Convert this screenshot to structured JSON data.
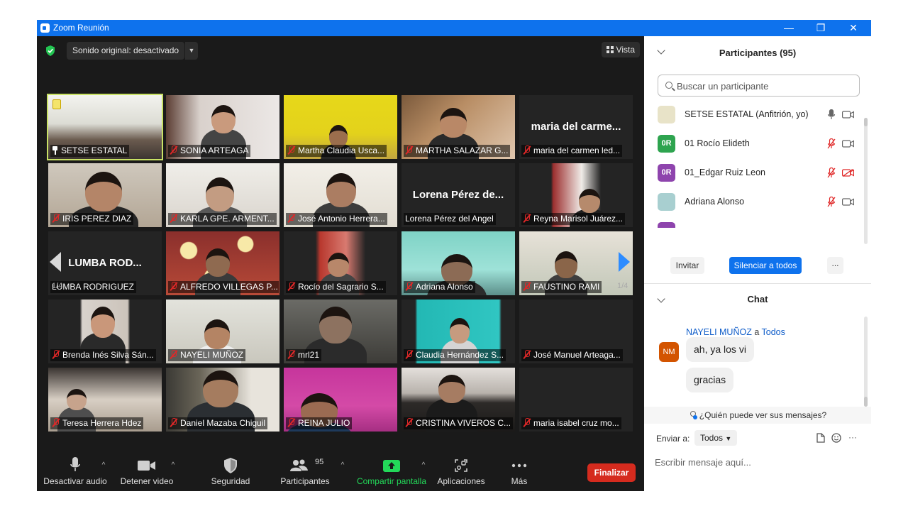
{
  "window": {
    "title": "Zoom Reunión",
    "controls": [
      "—",
      "❐",
      "✕"
    ]
  },
  "video_topbar": {
    "sound_label": "Sonido original: desactivado",
    "caret": "▼",
    "view_label": "Vista"
  },
  "pager": {
    "left_page": "1/4",
    "right_page": "1/4"
  },
  "tiles": [
    {
      "name": "SETSE ESTATAL",
      "pinned": true,
      "active": true
    },
    {
      "name": "SONIA ARTEAGA"
    },
    {
      "name": "Martha Claudia Usca..."
    },
    {
      "name": "MARTHA SALAZAR G..."
    },
    {
      "name": "maria del carmen led...",
      "big_name": "maria del carme..."
    },
    {
      "name": "IRIS PEREZ DIAZ"
    },
    {
      "name": "KARLA GPE. ARMENT..."
    },
    {
      "name": "José Antonio Herrera..."
    },
    {
      "name": "Lorena Pérez del Angel",
      "big_name": "Lorena Pérez de...",
      "no_mute": true
    },
    {
      "name": "Reyna Marisol Juárez..."
    },
    {
      "name": "LUMBA RODRIGUEZ",
      "big_name": "LUMBA  ROD...",
      "no_mute": true
    },
    {
      "name": "ALFREDO VILLEGAS P..."
    },
    {
      "name": "Rocío del Sagrario S..."
    },
    {
      "name": "Adriana Alonso"
    },
    {
      "name": "FAUSTINO RAMI"
    },
    {
      "name": "Brenda Inés Silva Sán..."
    },
    {
      "name": "NAYELI MUÑOZ"
    },
    {
      "name": "mrl21"
    },
    {
      "name": "Claudia Hernández S..."
    },
    {
      "name": "José Manuel Arteaga..."
    },
    {
      "name": "Teresa Herrera Hdez"
    },
    {
      "name": "Daniel Mazaba Chiguil"
    },
    {
      "name": "REINA JULIO"
    },
    {
      "name": "CRISTINA VIVEROS C..."
    },
    {
      "name": "maria isabel cruz mo..."
    }
  ],
  "toolbar": {
    "audio": "Desactivar audio",
    "video": "Detener video",
    "security": "Seguridad",
    "participants": "Participantes",
    "participants_count": "95",
    "share": "Compartir pantalla",
    "apps": "Aplicaciones",
    "more": "Más",
    "end": "Finalizar",
    "caret": "^"
  },
  "participants_panel": {
    "title": "Participantes (95)",
    "search_placeholder": "Buscar un participante",
    "items": [
      {
        "name": "SETSE ESTATAL (Anfitrión, yo)",
        "avatar": "",
        "avatar_color": "#e8e3c8",
        "mic_muted": false,
        "video_off": false
      },
      {
        "name": "01 Rocío Elideth",
        "avatar": "0R",
        "avatar_color": "#2ea44f",
        "mic_muted": true,
        "video_off": false
      },
      {
        "name": "01_Edgar Ruiz Leon",
        "avatar": "0R",
        "avatar_color": "#8e44ad",
        "mic_muted": true,
        "video_off": true
      },
      {
        "name": "Adriana Alonso",
        "avatar": "",
        "avatar_color": "#a8cfd0",
        "mic_muted": true,
        "video_off": false
      }
    ],
    "invite": "Invitar",
    "mute_all": "Silenciar a todos",
    "more": "..."
  },
  "chat_panel": {
    "title": "Chat",
    "sender": "NAYELI MUÑOZ",
    "to_word": "a",
    "recipient": "Todos",
    "sender_initials": "NM",
    "messages": [
      "ah, ya los vi",
      "gracias"
    ],
    "who_can_see": "¿Quién puede ver sus mensajes?",
    "send_to_label": "Enviar a:",
    "send_to_value": "Todos",
    "more": "···",
    "input_placeholder": "Escribir mensaje aquí..."
  },
  "colors": {
    "titlebar": "#0e72ed",
    "end_button": "#d52b1e",
    "mute_all": "#0e72ed",
    "share_green": "#23d959",
    "mute_red": "#e02828"
  }
}
